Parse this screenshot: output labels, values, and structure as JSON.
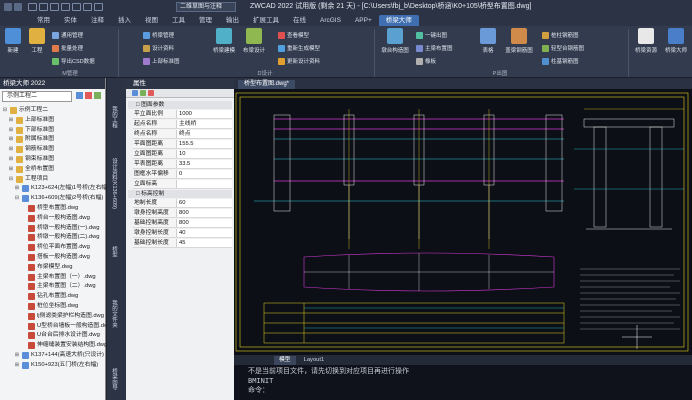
{
  "window": {
    "title": "ZWCAD 2022 试用版 (剩余 21 天) - [C:\\Users\\fbj_b\\Desktop\\桥涵\\K0+105\\桥型布置图.dwg]",
    "workspace": "二维草图与注释"
  },
  "menu": [
    "常用",
    "实体",
    "注释",
    "插入",
    "视图",
    "工具",
    "管理",
    "输出",
    "扩展工具",
    "在线",
    "ArcGIS",
    "APP+",
    "桥梁大师"
  ],
  "menu_active": "桥梁大师",
  "ribbon": {
    "big_buttons": [
      "新建",
      "工程"
    ],
    "group1_items": [
      "通用管理",
      "批量处理",
      "导出CSD数据"
    ],
    "group2_items": [
      "桥梁管理",
      "设计资料",
      "上部标准图"
    ],
    "group3_big": [
      "桥梁建模",
      "布梁设计"
    ],
    "group3_items": [
      "查看模型",
      "重新生成模型",
      "更新设计资料"
    ],
    "group4_big": [
      "墩台构造图"
    ],
    "group4_items": [
      "一键出图",
      "主梁布置图",
      "橡板"
    ],
    "group5_big": [
      "表格",
      "盖梁钢筋图"
    ],
    "group5_items": [
      "桩柱钢筋图",
      "轻型台钢筋图",
      "柱基钢筋图"
    ],
    "group6_big": [
      "桥梁资源",
      "桥梁大师"
    ],
    "group_labels": [
      "M管理",
      "D设计",
      "P出图"
    ]
  },
  "left_panel": {
    "title": "桥梁大师 2022",
    "project_combo": "示例工程二",
    "tree": [
      {
        "label": "示例工程二",
        "level": 0,
        "toggle": "⊟",
        "icon": "folder"
      },
      {
        "label": "上部标准图",
        "level": 1,
        "toggle": "⊞",
        "icon": "folder"
      },
      {
        "label": "下部标准图",
        "level": 1,
        "toggle": "⊞",
        "icon": "folder"
      },
      {
        "label": "附属标准图",
        "level": 1,
        "toggle": "⊞",
        "icon": "folder"
      },
      {
        "label": "钢筋标准图",
        "level": 1,
        "toggle": "⊞",
        "icon": "folder"
      },
      {
        "label": "钢束标准图",
        "level": 1,
        "toggle": "⊞",
        "icon": "folder"
      },
      {
        "label": "全桥布置图",
        "level": 1,
        "toggle": "⊞",
        "icon": "folder"
      },
      {
        "label": "工程项目",
        "level": 1,
        "toggle": "⊟",
        "icon": "folder"
      },
      {
        "label": "K123+624(左幅)1号桥(左右幅)",
        "level": 2,
        "toggle": "⊞",
        "icon": "bridge"
      },
      {
        "label": "K136+609(左幅)2号桥(右幅)",
        "level": 2,
        "toggle": "⊟",
        "icon": "bridge"
      },
      {
        "label": "桥型布置图.dwg",
        "level": 3,
        "toggle": "",
        "icon": "dwg"
      },
      {
        "label": "桥台一般构造图.dwg",
        "level": 3,
        "toggle": "",
        "icon": "dwg"
      },
      {
        "label": "桥墩一般构造图(一).dwg",
        "level": 3,
        "toggle": "",
        "icon": "dwg"
      },
      {
        "label": "桥墩一般构造图(二).dwg",
        "level": 3,
        "toggle": "",
        "icon": "dwg"
      },
      {
        "label": "桥位平面布置图.dwg",
        "level": 3,
        "toggle": "",
        "icon": "dwg"
      },
      {
        "label": "搭板一般构造图.dwg",
        "level": 3,
        "toggle": "",
        "icon": "dwg"
      },
      {
        "label": "布梁模型.dwg",
        "level": 3,
        "toggle": "",
        "icon": "dwg"
      },
      {
        "label": "主梁布置图（一）.dwg",
        "level": 3,
        "toggle": "",
        "icon": "dwg"
      },
      {
        "label": "主梁布置图（二）.dwg",
        "level": 3,
        "toggle": "",
        "icon": "dwg"
      },
      {
        "label": "钻孔布置图.dwg",
        "level": 3,
        "toggle": "",
        "icon": "dwg"
      },
      {
        "label": "桩位坐标图.dwg",
        "level": 3,
        "toggle": "",
        "icon": "dwg"
      },
      {
        "label": "lj侧滤类梁护栏构造图.dwg",
        "level": 3,
        "toggle": "",
        "icon": "dwg"
      },
      {
        "label": "U型桥台墙板一般构造图.dwg",
        "level": 3,
        "toggle": "",
        "icon": "dwg"
      },
      {
        "label": "U台台后排水设计图.dwg",
        "level": 3,
        "toggle": "",
        "icon": "dwg"
      },
      {
        "label": "伸缩缝装置安装结构图.dwg",
        "level": 3,
        "toggle": "",
        "icon": "dwg"
      },
      {
        "label": "K137+144(高速大桥(只设计)",
        "level": 2,
        "toggle": "⊞",
        "icon": "bridge"
      },
      {
        "label": "K150+923(五门桥(左右幅)",
        "level": 2,
        "toggle": "⊞",
        "icon": "bridge"
      }
    ]
  },
  "vertical_tabs": [
    "我的工程",
    "设计资料(K136+609)",
    "桥型",
    "我的文件夹",
    "桥梁向导"
  ],
  "properties": {
    "title": "属性",
    "sections": [
      {
        "name": "□ 图面参数",
        "rows": [
          {
            "k": "平立面比例",
            "v": "1000"
          },
          {
            "k": "起点名称",
            "v": "主线桥"
          },
          {
            "k": "终点名称",
            "v": "终点"
          },
          {
            "k": "平面图距离",
            "v": "155.5"
          },
          {
            "k": "立面图距离",
            "v": "10"
          },
          {
            "k": "平表图距离",
            "v": "33.5"
          },
          {
            "k": "图框水平偏移",
            "v": "0"
          },
          {
            "k": "立面标高",
            "v": ""
          }
        ]
      },
      {
        "name": "□ 标高控制",
        "rows": [
          {
            "k": "地制长度",
            "v": "60"
          },
          {
            "k": "墩身控制高度",
            "v": "800"
          },
          {
            "k": "基础控制高度",
            "v": "800"
          },
          {
            "k": "墩身控制长度",
            "v": "40"
          },
          {
            "k": "基础控制长度",
            "v": "45"
          }
        ]
      }
    ]
  },
  "canvas": {
    "doc_tabs": [
      "桥型布置图.dwg*"
    ],
    "layout_tabs": [
      "模型",
      "Layout1"
    ],
    "active_layout": "模型"
  },
  "command": {
    "lines": [
      "不是当前项目文件，请先切换到对应项目再进行操作",
      "BMINIT",
      "命令："
    ]
  },
  "colors": {
    "accent": "#3f6fb0",
    "bg_dark": "#1e2430",
    "canvas": "#0c0f16",
    "cad_yellow": "#e6d21f",
    "cad_magenta": "#d63ad6",
    "cad_cyan": "#2fd0e0"
  }
}
